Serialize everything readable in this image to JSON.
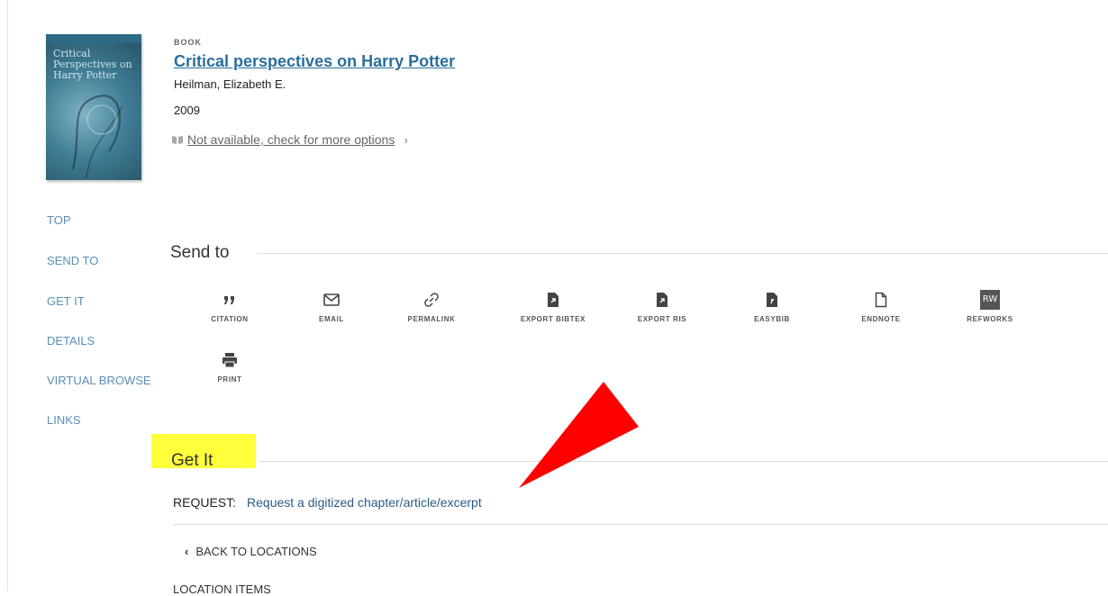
{
  "record": {
    "type": "BOOK",
    "title": "Critical perspectives on Harry Potter",
    "author": "Heilman, Elizabeth E.",
    "year": "2009",
    "availability": "Not available, check for more options",
    "availability_icon": "book-open-icon",
    "cover_title": "Critical Perspectives on Harry Potter"
  },
  "nav": {
    "items": [
      "TOP",
      "SEND TO",
      "GET IT",
      "DETAILS",
      "VIRTUAL BROWSE",
      "LINKS"
    ]
  },
  "send_to": {
    "heading": "Send to",
    "actions": [
      {
        "label": "CITATION",
        "icon": "quote-icon"
      },
      {
        "label": "EMAIL",
        "icon": "envelope-icon"
      },
      {
        "label": "PERMALINK",
        "icon": "link-icon"
      },
      {
        "label": "EXPORT BIBTEX",
        "icon": "file-export-icon"
      },
      {
        "label": "EXPORT RIS",
        "icon": "file-export-icon"
      },
      {
        "label": "EASYBIB",
        "icon": "file-export-icon"
      },
      {
        "label": "ENDNOTE",
        "icon": "document-icon"
      },
      {
        "label": "REFWORKS",
        "icon": "refworks-icon",
        "icon_text": "RW"
      },
      {
        "label": "PRINT",
        "icon": "printer-icon"
      }
    ]
  },
  "get_it": {
    "heading": "Get It",
    "request_label": "REQUEST:",
    "request_value": "Request a digitized chapter/article/excerpt",
    "back_label": "BACK TO LOCATIONS",
    "location_items": "LOCATION ITEMS"
  },
  "colors": {
    "link": "#2a6f9b",
    "nav": "#5a8fb5",
    "highlight": "#ffff3b",
    "arrow": "#ff0000"
  }
}
